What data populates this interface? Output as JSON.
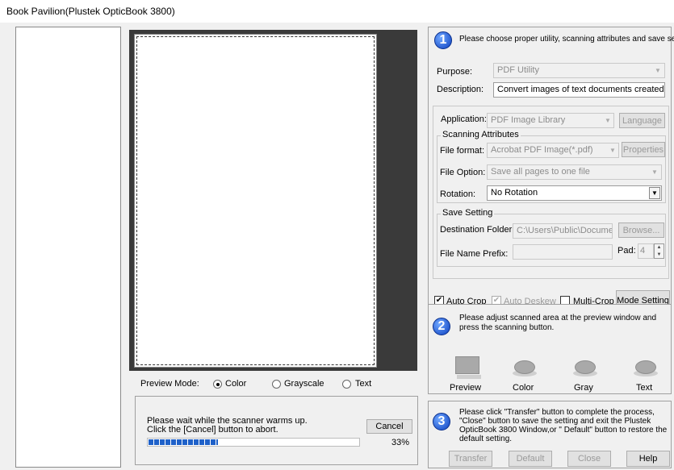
{
  "window": {
    "title": "Book Pavilion(Plustek OpticBook 3800)"
  },
  "preview_mode": {
    "label": "Preview Mode:",
    "options": [
      "Color",
      "Grayscale",
      "Text"
    ],
    "selected": "Color"
  },
  "status": {
    "line1": "Please wait while the scanner warms up.",
    "line2": "Click the [Cancel] button to abort.",
    "cancel_label": "Cancel",
    "progress_percent": 33,
    "progress_text": "33%"
  },
  "step1": {
    "number": "1",
    "instruction": "Please choose proper utility, scanning attributes and save settings.",
    "purpose_label": "Purpose:",
    "purpose_value": "PDF Utility",
    "description_label": "Description:",
    "description_value": "Convert images of text documents created by the",
    "application_label": "Application:",
    "application_value": "PDF Image Library",
    "language_label": "Language",
    "scanning_attributes_title": "Scanning Attributes",
    "file_format_label": "File format:",
    "file_format_value": "Acrobat PDF Image(*.pdf)",
    "properties_label": "Properties",
    "file_option_label": "File Option:",
    "file_option_value": "Save all pages to one file",
    "rotation_label": "Rotation:",
    "rotation_value": "No Rotation",
    "save_setting_title": "Save Setting",
    "destination_label": "Destination Folder:",
    "destination_value": "C:\\Users\\Public\\Document",
    "browse_label": "Browse...",
    "prefix_label": "File Name Prefix:",
    "prefix_value": "",
    "pad_label": "Pad:",
    "pad_value": "4",
    "auto_crop_label": "Auto Crop",
    "auto_crop_checked": true,
    "auto_deskew_label": "Auto Deskew",
    "auto_deskew_checked": true,
    "multi_crop_label": "Multi-Crop",
    "multi_crop_checked": false,
    "mode_setting_label": "Mode Setting"
  },
  "step2": {
    "number": "2",
    "instruction": "Please adjust scanned area at the preview window and press the scanning button.",
    "buttons": [
      "Preview",
      "Color",
      "Gray",
      "Text"
    ]
  },
  "step3": {
    "number": "3",
    "instruction": "Please click \"Transfer\" button to complete the process, \"Close\" button to save the setting and exit the Plustek OpticBook 3800 Window,or \" Default\" button to restore the default setting.",
    "transfer_label": "Transfer",
    "default_label": "Default",
    "close_label": "Close",
    "help_label": "Help"
  },
  "colors": {
    "progress": "#1f61c9",
    "step_circle": "#1550d6"
  }
}
